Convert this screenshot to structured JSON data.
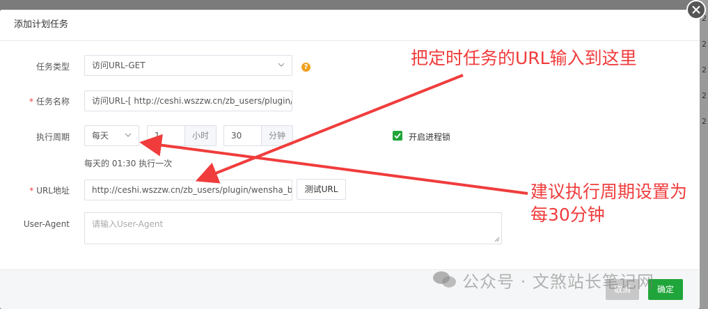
{
  "background_numbers": [
    "2",
    "2",
    "2",
    "2",
    "2"
  ],
  "dialog": {
    "title": "添加计划任务"
  },
  "form": {
    "task_type": {
      "label": "任务类型",
      "value": "访问URL-GET"
    },
    "task_name": {
      "label": "任务名称",
      "value": "访问URL-[ http://ceshi.wszzw.cn/zb_users/plugin/"
    },
    "period": {
      "label": "执行周期",
      "select_value": "每天",
      "hour_value": "1",
      "hour_unit": "小时",
      "minute_value": "30",
      "minute_unit": "分钟",
      "hint": "每天的 01:30 执行一次"
    },
    "process_lock": {
      "label": "开启进程锁",
      "checked": true
    },
    "url": {
      "label": "URL地址",
      "value": "http://ceshi.wszzw.cn/zb_users/plugin/wensha_b",
      "test_button": "测试URL"
    },
    "user_agent": {
      "label": "User-Agent",
      "placeholder": "请输入User-Agent"
    },
    "required_mark": "*",
    "help_mark": "?"
  },
  "annotations": {
    "top": "把定时任务的URL输入到这里",
    "right_line1": "建议执行周期设置为",
    "right_line2": "每30分钟"
  },
  "watermark": "公众号 · 文煞站长笔记网",
  "footer": {
    "cancel": "取消",
    "confirm": "确定"
  },
  "colors": {
    "accent_green": "#20a53a",
    "annotation_red": "#f03c3c",
    "help_orange": "#f0a020"
  }
}
